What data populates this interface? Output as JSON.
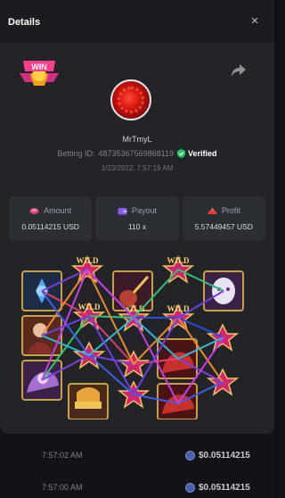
{
  "modal": {
    "title": "Details",
    "close_icon": "×"
  },
  "badge": {
    "text": "WIN"
  },
  "player": {
    "username": "MrTmyL",
    "betting_id_label": "Betting ID:",
    "betting_id": "48735367569868119",
    "verified_label": "Verified",
    "datetime": "1/23/2022, 7:57:19 AM"
  },
  "stats": {
    "amount": {
      "label": "Amount",
      "value": "0.05114215 USD",
      "color": "#e0457b"
    },
    "payout": {
      "label": "Payout",
      "value": "110 x",
      "color": "#8a5cf6"
    },
    "profit": {
      "label": "Profit",
      "value": "5.57449457 USD",
      "color": "#e23b3b"
    }
  },
  "game": {
    "wild_label": "WILD"
  },
  "history": [
    {
      "time": "7:57:02 AM",
      "amount": "$0.05114215"
    },
    {
      "time": "7:57:00 AM",
      "amount": "$0.05114215"
    }
  ],
  "colors": {
    "verified": "#22c55e",
    "background": "#222428"
  }
}
